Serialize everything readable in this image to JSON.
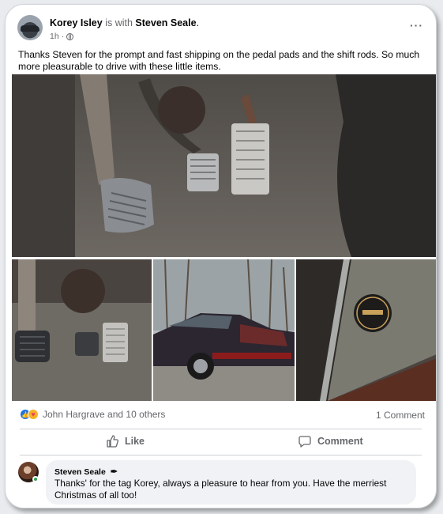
{
  "post": {
    "author": "Korey Isley",
    "with_text": "is with",
    "tagged": "Steven Seale",
    "tagged_suffix": ".",
    "time": "1h",
    "privacy_icon": "globe-icon",
    "more_icon": "more-icon",
    "text": "Thanks Steven for the prompt and fast shipping on the pedal pads and the shift rods. So much more pleasurable to drive with these little items."
  },
  "photos": [
    {
      "name": "pedals-closeup-photo"
    },
    {
      "name": "pedals-wide-photo"
    },
    {
      "name": "car-photo"
    },
    {
      "name": "window-sticker-photo"
    }
  ],
  "reactions": {
    "icons": [
      "like-react-icon",
      "care-react-icon"
    ],
    "names": "John Hargrave and 10 others",
    "comments": "1 Comment"
  },
  "actions": {
    "like_label": "Like",
    "comment_label": "Comment"
  },
  "comment": {
    "author": "Steven Seale",
    "badge_icon": "pen-icon",
    "text": "Thanks' for the tag Korey, always a pleasure to hear from you. Have the merriest Christmas of all too!"
  },
  "colors": {
    "brand_blue": "#1b74e4",
    "muted_text": "#65676b",
    "bubble_bg": "#f0f2f5",
    "online_green": "#31a24c"
  }
}
